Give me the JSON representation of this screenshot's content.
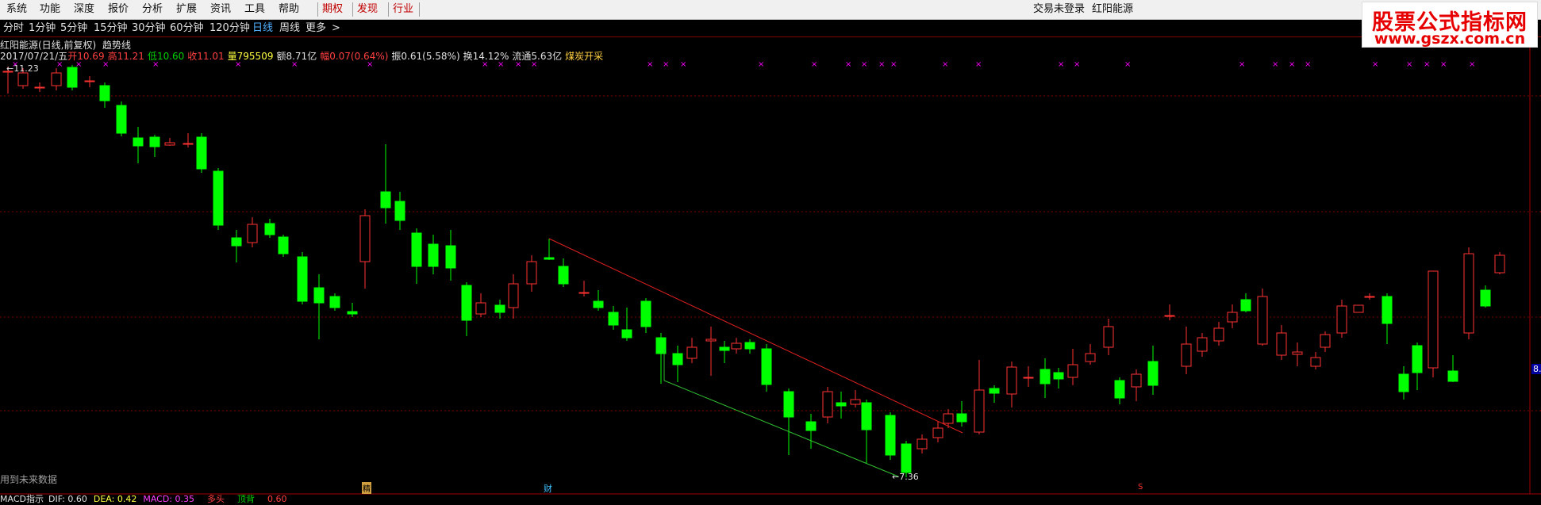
{
  "menu": {
    "items": [
      "系统",
      "功能",
      "深度",
      "报价",
      "分析",
      "扩展",
      "资讯",
      "工具",
      "帮助"
    ],
    "highlight_items": [
      "期权",
      "发现",
      "行业"
    ],
    "right": [
      "交易未登录",
      "红阳能源"
    ]
  },
  "logo": {
    "line1": "股票公式指标网",
    "line2": "www.gszx.com.cn"
  },
  "periods": {
    "items": [
      "分时",
      "1分钟",
      "5分钟",
      "15分钟",
      "30分钟",
      "60分钟",
      "120分钟",
      "日线",
      "周线",
      "更多"
    ],
    "active": "日线",
    "more_arrow": ">"
  },
  "title": {
    "stock": "红阳能源(日线,前复权)",
    "indicator": "趋势线"
  },
  "info": {
    "date": "2017/07/21/五",
    "open": "开10.69",
    "high": "高11.21",
    "low": "低10.60",
    "close": "收11.01",
    "volume": "量795509",
    "amount": "额8.71亿",
    "change": "幅0.07(0.64%)",
    "amplitude": "振0.61(5.58%)",
    "turnover": "换14.12%",
    "float": "流通5.63亿",
    "sector": "煤炭开采"
  },
  "chart": {
    "high_label": "11.23",
    "low_label": "7.36",
    "warning": "用到未来数据",
    "markers": [
      "精",
      "财",
      "S"
    ],
    "right_value": "8.",
    "colors": {
      "up": "#ff3232",
      "down": "#00ff00",
      "grid": "#800000",
      "mark": "#ff00ff",
      "upper_trend": "#e02020",
      "lower_trend": "#30c030"
    }
  },
  "macd": {
    "name": "MACD指示",
    "dif": "DIF: 0.60",
    "dea": "DEA: 0.42",
    "macd": "MACD: 0.35",
    "extra1": "多头",
    "extra2": "顶背",
    "extra3": "0.60"
  }
}
